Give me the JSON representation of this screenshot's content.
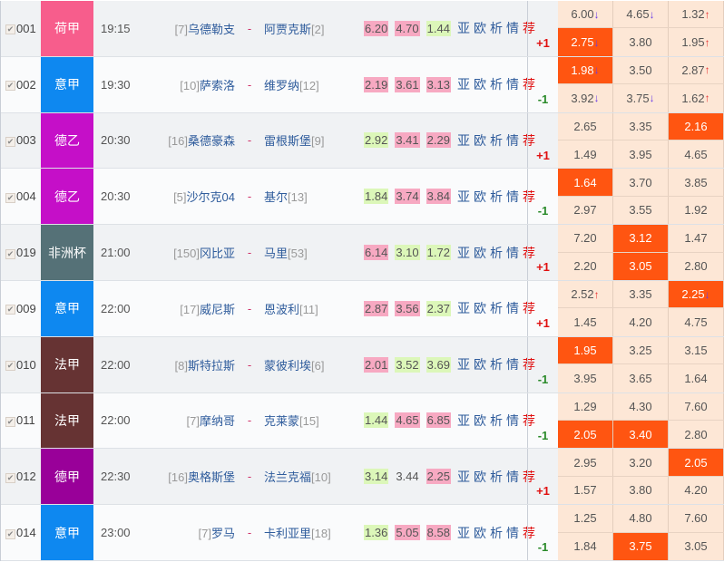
{
  "links": [
    "亚",
    "欧",
    "析",
    "情",
    "荐"
  ],
  "colors": {
    "highlight": "#ff5511",
    "cell": "#fde7d6",
    "pink": "#f7a9c2",
    "green": "#dcf7b9"
  },
  "matches": [
    {
      "id": "001",
      "league": "荷甲",
      "league_color": "#f75d8c",
      "time": "19:15",
      "home_rank": "[7]",
      "home": "乌德勒支",
      "away": "阿贾克斯",
      "away_rank": "[2]",
      "odds": [
        {
          "v": "6.20",
          "c": "pink"
        },
        {
          "v": "4.70",
          "c": "pink"
        },
        {
          "v": "1.44",
          "c": "green"
        }
      ],
      "handicap": "+1",
      "grid": [
        [
          {
            "v": "6.00",
            "a": "down"
          },
          {
            "v": "4.65",
            "a": "down"
          },
          {
            "v": "1.32",
            "a": "up"
          }
        ],
        [
          {
            "v": "2.75",
            "a": "down",
            "hl": true
          },
          {
            "v": "3.80"
          },
          {
            "v": "1.95",
            "a": "up"
          }
        ]
      ]
    },
    {
      "id": "002",
      "league": "意甲",
      "league_color": "#0e88f0",
      "time": "19:30",
      "home_rank": "[10]",
      "home": "萨索洛",
      "away": "维罗纳",
      "away_rank": "[12]",
      "odds": [
        {
          "v": "2.19",
          "c": "pink"
        },
        {
          "v": "3.61",
          "c": "pink"
        },
        {
          "v": "3.13",
          "c": "pink"
        }
      ],
      "handicap": "-1",
      "grid": [
        [
          {
            "v": "1.98",
            "a": "down",
            "hl": true
          },
          {
            "v": "3.50"
          },
          {
            "v": "2.87",
            "a": "up"
          }
        ],
        [
          {
            "v": "3.92",
            "a": "down"
          },
          {
            "v": "3.75",
            "a": "down"
          },
          {
            "v": "1.62",
            "a": "up"
          }
        ]
      ]
    },
    {
      "id": "003",
      "league": "德乙",
      "league_color": "#c50fc8",
      "time": "20:30",
      "home_rank": "[16]",
      "home": "桑德豪森",
      "away": "雷根斯堡",
      "away_rank": "[9]",
      "odds": [
        {
          "v": "2.92",
          "c": "green"
        },
        {
          "v": "3.41",
          "c": "pink"
        },
        {
          "v": "2.29",
          "c": "pink"
        }
      ],
      "handicap": "+1",
      "grid": [
        [
          {
            "v": "2.65"
          },
          {
            "v": "3.35"
          },
          {
            "v": "2.16",
            "hl": true
          }
        ],
        [
          {
            "v": "1.49"
          },
          {
            "v": "3.95"
          },
          {
            "v": "4.65"
          }
        ]
      ]
    },
    {
      "id": "004",
      "league": "德乙",
      "league_color": "#c50fc8",
      "time": "20:30",
      "home_rank": "[5]",
      "home": "沙尔克04",
      "away": "基尔",
      "away_rank": "[13]",
      "odds": [
        {
          "v": "1.84",
          "c": "green"
        },
        {
          "v": "3.74",
          "c": "pink"
        },
        {
          "v": "3.84",
          "c": "pink"
        }
      ],
      "handicap": "-1",
      "grid": [
        [
          {
            "v": "1.64",
            "hl": true
          },
          {
            "v": "3.70"
          },
          {
            "v": "3.85"
          }
        ],
        [
          {
            "v": "2.97"
          },
          {
            "v": "3.55"
          },
          {
            "v": "1.92"
          }
        ]
      ]
    },
    {
      "id": "019",
      "league": "非洲杯",
      "league_color": "#557177",
      "time": "21:00",
      "home_rank": "[150]",
      "home": "冈比亚",
      "away": "马里",
      "away_rank": "[53]",
      "odds": [
        {
          "v": "6.14",
          "c": "pink"
        },
        {
          "v": "3.10",
          "c": "green"
        },
        {
          "v": "1.72",
          "c": "green"
        }
      ],
      "handicap": "+1",
      "grid": [
        [
          {
            "v": "7.20"
          },
          {
            "v": "3.12",
            "hl": true
          },
          {
            "v": "1.47"
          }
        ],
        [
          {
            "v": "2.20"
          },
          {
            "v": "3.05",
            "hl": true
          },
          {
            "v": "2.80"
          }
        ]
      ]
    },
    {
      "id": "009",
      "league": "意甲",
      "league_color": "#0e88f0",
      "time": "22:00",
      "home_rank": "[17]",
      "home": "威尼斯",
      "away": "恩波利",
      "away_rank": "[11]",
      "odds": [
        {
          "v": "2.87",
          "c": "pink"
        },
        {
          "v": "3.56",
          "c": "pink"
        },
        {
          "v": "2.37",
          "c": "green"
        }
      ],
      "handicap": "+1",
      "grid": [
        [
          {
            "v": "2.52",
            "a": "up"
          },
          {
            "v": "3.35"
          },
          {
            "v": "2.25",
            "a": "down",
            "hl": true
          }
        ],
        [
          {
            "v": "1.45"
          },
          {
            "v": "4.20"
          },
          {
            "v": "4.75"
          }
        ]
      ]
    },
    {
      "id": "010",
      "league": "法甲",
      "league_color": "#663333",
      "time": "22:00",
      "home_rank": "[8]",
      "home": "斯特拉斯",
      "away": "蒙彼利埃",
      "away_rank": "[6]",
      "odds": [
        {
          "v": "2.01",
          "c": "pink"
        },
        {
          "v": "3.52",
          "c": "green"
        },
        {
          "v": "3.69",
          "c": "green"
        }
      ],
      "handicap": "-1",
      "grid": [
        [
          {
            "v": "1.95",
            "hl": true
          },
          {
            "v": "3.25"
          },
          {
            "v": "3.15"
          }
        ],
        [
          {
            "v": "3.95"
          },
          {
            "v": "3.65"
          },
          {
            "v": "1.64"
          }
        ]
      ]
    },
    {
      "id": "011",
      "league": "法甲",
      "league_color": "#663333",
      "time": "22:00",
      "home_rank": "[7]",
      "home": "摩纳哥",
      "away": "克莱蒙",
      "away_rank": "[15]",
      "odds": [
        {
          "v": "1.44",
          "c": "green"
        },
        {
          "v": "4.65",
          "c": "pink"
        },
        {
          "v": "6.85",
          "c": "pink"
        }
      ],
      "handicap": "-1",
      "grid": [
        [
          {
            "v": "1.29"
          },
          {
            "v": "4.30"
          },
          {
            "v": "7.60"
          }
        ],
        [
          {
            "v": "2.05",
            "hl": true
          },
          {
            "v": "3.40",
            "hl": true
          },
          {
            "v": "2.80"
          }
        ]
      ]
    },
    {
      "id": "012",
      "league": "德甲",
      "league_color": "#990099",
      "time": "22:30",
      "home_rank": "[16]",
      "home": "奥格斯堡",
      "away": "法兰克福",
      "away_rank": "[10]",
      "odds": [
        {
          "v": "3.14",
          "c": "green"
        },
        {
          "v": "3.44",
          "c": ""
        },
        {
          "v": "2.25",
          "c": "pink"
        }
      ],
      "handicap": "+1",
      "grid": [
        [
          {
            "v": "2.95"
          },
          {
            "v": "3.20"
          },
          {
            "v": "2.05",
            "hl": true
          }
        ],
        [
          {
            "v": "1.57"
          },
          {
            "v": "3.80"
          },
          {
            "v": "4.20"
          }
        ]
      ]
    },
    {
      "id": "014",
      "league": "意甲",
      "league_color": "#0e88f0",
      "time": "23:00",
      "home_rank": "[7]",
      "home": "罗马",
      "away": "卡利亚里",
      "away_rank": "[18]",
      "odds": [
        {
          "v": "1.36",
          "c": "green"
        },
        {
          "v": "5.05",
          "c": "pink"
        },
        {
          "v": "8.58",
          "c": "pink"
        }
      ],
      "handicap": "-1",
      "grid": [
        [
          {
            "v": "1.25"
          },
          {
            "v": "4.80"
          },
          {
            "v": "7.60"
          }
        ],
        [
          {
            "v": "1.84"
          },
          {
            "v": "3.75",
            "hl": true
          },
          {
            "v": "3.05"
          }
        ]
      ]
    }
  ]
}
